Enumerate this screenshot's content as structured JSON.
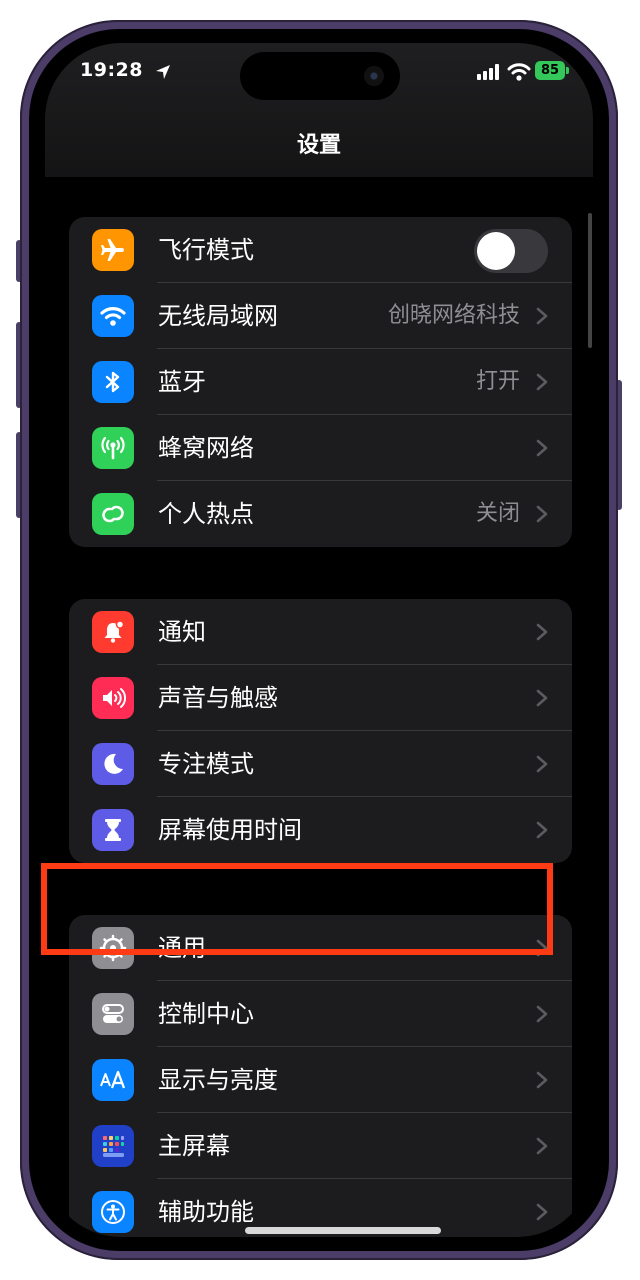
{
  "status_bar": {
    "time": "19:28",
    "battery": "85"
  },
  "nav": {
    "title": "设置"
  },
  "colors": {
    "highlight": "#ff3b16",
    "airplane": "#ff9500",
    "wifi": "#0a84ff",
    "bluetooth": "#0a84ff",
    "cellular": "#30d158",
    "hotspot": "#30d158",
    "notifications": "#ff3b30",
    "sounds": "#ff2d55",
    "focus": "#5e5ce6",
    "screen_time": "#5e5ce6",
    "general": "#8e8e93"
  },
  "groups": [
    {
      "rows": [
        {
          "icon": "airplane-icon",
          "label": "飞行模式",
          "toggle_on": false
        },
        {
          "icon": "wifi-icon",
          "label": "无线局域网",
          "value": "创晓网络科技"
        },
        {
          "icon": "bluetooth-icon",
          "label": "蓝牙",
          "value": "打开"
        },
        {
          "icon": "cellular-icon",
          "label": "蜂窝网络",
          "value": ""
        },
        {
          "icon": "hotspot-icon",
          "label": "个人热点",
          "value": "关闭"
        }
      ]
    },
    {
      "rows": [
        {
          "icon": "notifications-icon",
          "label": "通知"
        },
        {
          "icon": "sounds-icon",
          "label": "声音与触感"
        },
        {
          "icon": "focus-moon-icon",
          "label": "专注模式"
        },
        {
          "icon": "hourglass-icon",
          "label": "屏幕使用时间"
        }
      ]
    },
    {
      "rows": [
        {
          "icon": "gear-icon",
          "label": "通用",
          "highlighted": true
        },
        {
          "icon": "control-center-icon",
          "label": "控制中心"
        },
        {
          "icon": "display-brightness-icon",
          "label": "显示与亮度"
        },
        {
          "icon": "home-screen-icon",
          "label": "主屏幕"
        },
        {
          "icon": "accessibility-icon",
          "label": "辅助功能"
        }
      ]
    }
  ]
}
